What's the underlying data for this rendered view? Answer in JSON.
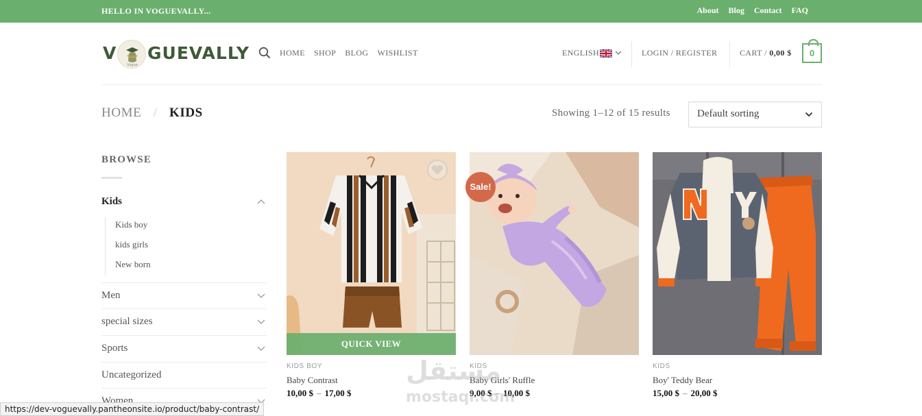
{
  "topbar": {
    "greeting": "HELLO IN VOGUEVALLY...",
    "links": [
      "About",
      "Blog",
      "Contact",
      "FAQ"
    ]
  },
  "header": {
    "logo_v": "V",
    "logo_rest": "GUEVALLY",
    "nav": [
      "HOME",
      "SHOP",
      "BLOG",
      "WISHLIST"
    ],
    "language": "ENGLISH",
    "login": "LOGIN / REGISTER",
    "cart_label": "CART /",
    "cart_total": "0,00 $",
    "cart_count": "0"
  },
  "breadcrumb": {
    "home": "HOME",
    "separator": "/",
    "current": "KIDS"
  },
  "results_text": "Showing 1–12 of 15 results",
  "sorting": {
    "selected": "Default sorting"
  },
  "sidebar": {
    "title": "BROWSE",
    "active_category": "Kids",
    "subcategories": [
      "Kids boy",
      "kids girls",
      "New born"
    ],
    "categories": [
      "Men",
      "special sizes",
      "Sports",
      "Uncategorized",
      "Women"
    ]
  },
  "products": [
    {
      "category": "KIDS BOY",
      "name": "Baby Contrast",
      "price_from": "10,00 $",
      "price_to": "17,00 $",
      "quick_view": "QUICK VIEW"
    },
    {
      "category": "KIDS",
      "name": "Baby Girls' Ruffle",
      "price_from": "9,00 $",
      "price_to": "10,00 $",
      "badge": "Sale!"
    },
    {
      "category": "KIDS",
      "name": "Boy' Teddy Bear",
      "price_from": "15,00 $",
      "price_to": "20,00 $"
    }
  ],
  "price_separator": "–",
  "watermark": {
    "arabic": "مستقل",
    "latin": "mostaql.com"
  },
  "status_url": "https://dev-voguevally.pantheonsite.io/product/baby-contrast/",
  "colors": {
    "brand_green": "#6aaf6d",
    "logo_green": "#3e5a37",
    "sale_badge": "#d3684a"
  }
}
